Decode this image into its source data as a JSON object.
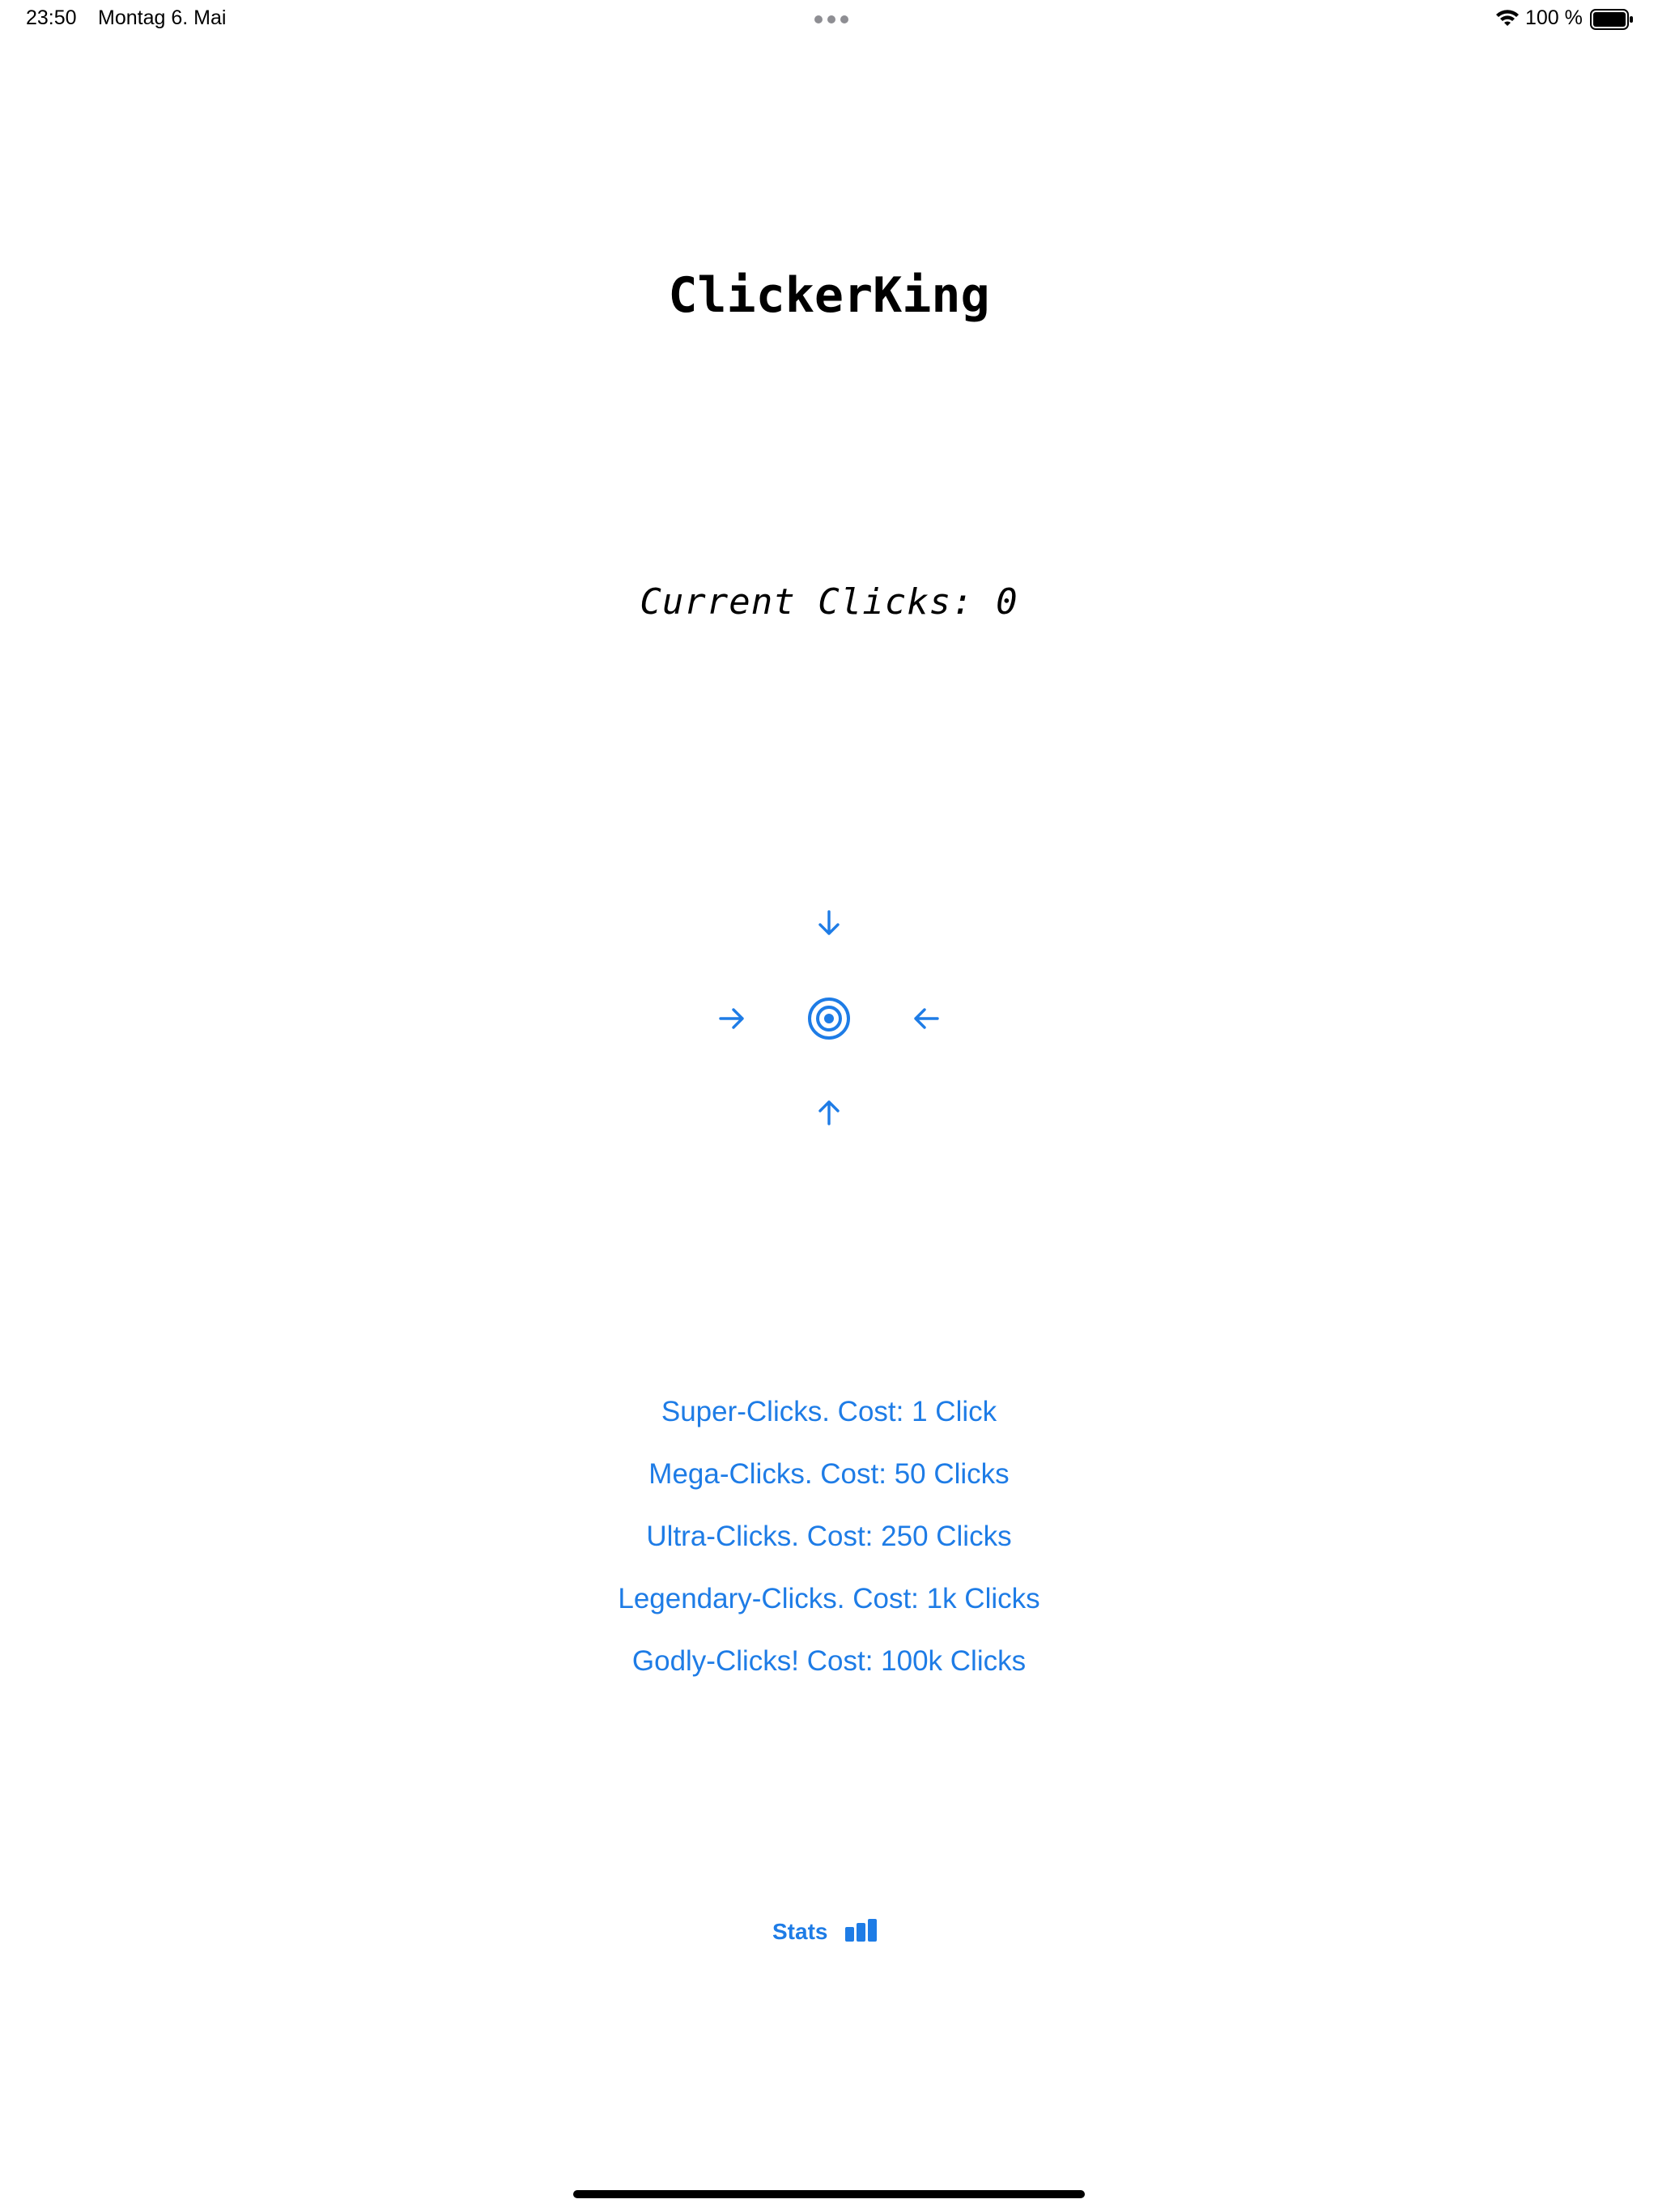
{
  "status_bar": {
    "time": "23:50",
    "date": "Montag 6. Mai",
    "battery_percent": "100 %"
  },
  "app": {
    "title": "ClickerKing",
    "current_clicks_label": "Current Clicks: 0"
  },
  "clicker": {
    "arrow_icons": [
      "arrow-down-icon",
      "arrow-right-icon",
      "arrow-left-icon",
      "arrow-up-icon"
    ],
    "target_icon": "target-icon",
    "accent_color": "#1E7CE6"
  },
  "upgrades": [
    {
      "label": "Super-Clicks. Cost: 1 Click"
    },
    {
      "label": "Mega-Clicks. Cost: 50 Clicks"
    },
    {
      "label": "Ultra-Clicks. Cost: 250 Clicks"
    },
    {
      "label": "Legendary-Clicks. Cost: 1k Clicks"
    },
    {
      "label": "Godly-Clicks! Cost: 100k Clicks"
    }
  ],
  "stats": {
    "label": "Stats",
    "icon": "bar-chart-icon"
  }
}
